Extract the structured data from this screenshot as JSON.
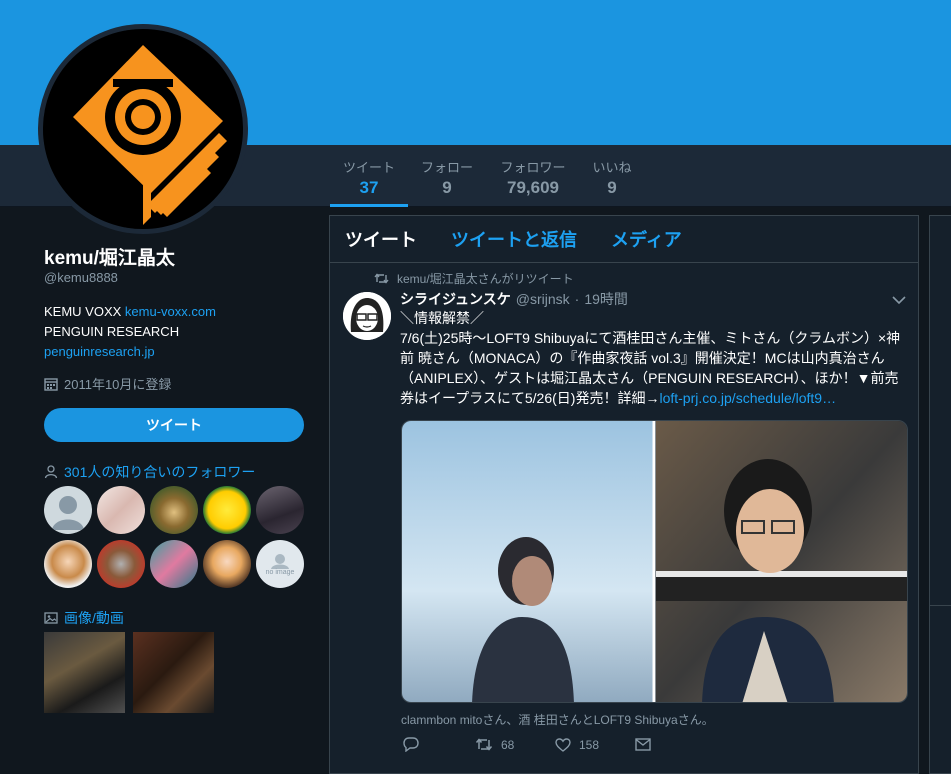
{
  "profile": {
    "name": "kemu/堀江晶太",
    "handle": "@kemu8888",
    "bio_line1_text": "KEMU VOXX ",
    "bio_line1_link": "kemu-voxx.com",
    "bio_line2": "PENGUIN RESEARCH",
    "bio_line3_link": "penguinresearch.jp",
    "joined": "2011年10月に登録",
    "tweet_button": "ツイート",
    "followers_you_know": "301人の知り合いのフォロワー",
    "media_label": "画像/動画",
    "no_image_text": "no image"
  },
  "stats": [
    {
      "label": "ツイート",
      "value": "37"
    },
    {
      "label": "フォロー",
      "value": "9"
    },
    {
      "label": "フォロワー",
      "value": "79,609"
    },
    {
      "label": "いいね",
      "value": "9"
    }
  ],
  "tabs": [
    "ツイート",
    "ツイートと返信",
    "メディア"
  ],
  "tweet": {
    "retweet_note": "kemu/堀江晶太さんがリツイート",
    "author": "シライジュンスケ",
    "author_handle": "@srijnsk",
    "dot": "·",
    "time": "19時間",
    "text_line1": "＼情報解禁／",
    "text_body": "7/6(土)25時〜LOFT9 Shibuyaにて酒桂田さん主催、ミトさん（クラムボン）×神前 暁さん（MONACA）の『作曲家夜話 vol.3』開催決定！MCは山内真治さん（ANIPLEX）、ゲストは堀江晶太さん（PENGUIN RESEARCH）、ほか！▼前売券はイープラスにて5/26(日)発売！詳細→",
    "text_link": "loft-prj.co.jp/schedule/loft9…",
    "tagged": "clammbon mitoさん、酒 桂田さんとLOFT9 Shibuyaさん。",
    "retweets": "68",
    "likes": "158"
  },
  "colors": {
    "accent": "#1da1f2",
    "banner": "#1b95e0",
    "background": "#10171e",
    "nav": "#1c2938",
    "logo_orange": "#f7931e"
  }
}
